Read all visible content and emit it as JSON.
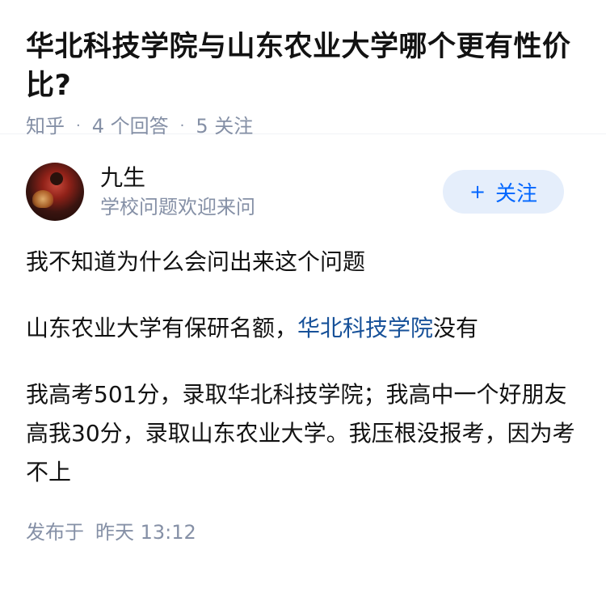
{
  "question": {
    "title": "华北科技学院与山东农业大学哪个更有性价比?",
    "site": "知乎",
    "answer_count": "4 个回答",
    "follower_count": "5 关注"
  },
  "answer": {
    "author": {
      "name": "九生",
      "headline": "学校问题欢迎来问",
      "follow_label": "关注",
      "follow_icon": "plus-icon"
    },
    "paragraph1": "我不知道为什么会问出来这个问题",
    "paragraph2_before": "山东农业大学有保研名额，",
    "paragraph2_link": "华北科技学院",
    "paragraph2_after": "没有",
    "paragraph3": "我高考501分，录取华北科技学院；我高中一个好朋友高我30分，录取山东农业大学。我压根没报考，因为考不上",
    "publish_label": "发布于",
    "publish_time": "昨天 13:12"
  },
  "colors": {
    "text_primary": "#121212",
    "text_secondary": "#8590a6",
    "link": "#175199",
    "follow_bg": "#e5eefb",
    "follow_text": "#0066ff"
  }
}
